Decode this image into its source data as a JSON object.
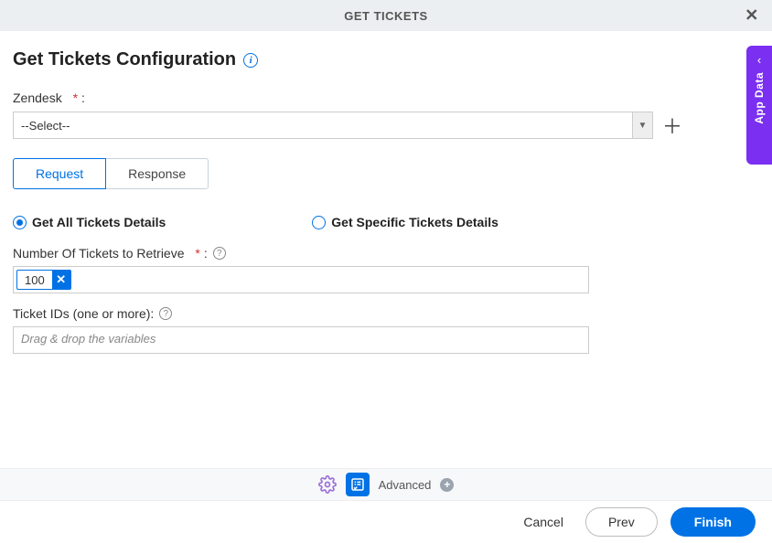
{
  "header": {
    "title": "GET TICKETS"
  },
  "page": {
    "title": "Get Tickets Configuration"
  },
  "zendesk": {
    "label": "Zendesk",
    "required_mark": "*",
    "colon": ":",
    "selected": "--Select--"
  },
  "tabs": {
    "request": "Request",
    "response": "Response"
  },
  "radios": {
    "all": "Get All Tickets Details",
    "specific": "Get Specific Tickets Details"
  },
  "number_field": {
    "label": "Number Of Tickets to Retrieve",
    "required_mark": "*",
    "colon": ":",
    "chip_value": "100"
  },
  "ids_field": {
    "label": "Ticket IDs (one or more):",
    "placeholder": "Drag & drop the variables"
  },
  "toolbar": {
    "advanced": "Advanced"
  },
  "footer": {
    "cancel": "Cancel",
    "prev": "Prev",
    "finish": "Finish"
  },
  "sidepanel": {
    "label": "App Data"
  }
}
